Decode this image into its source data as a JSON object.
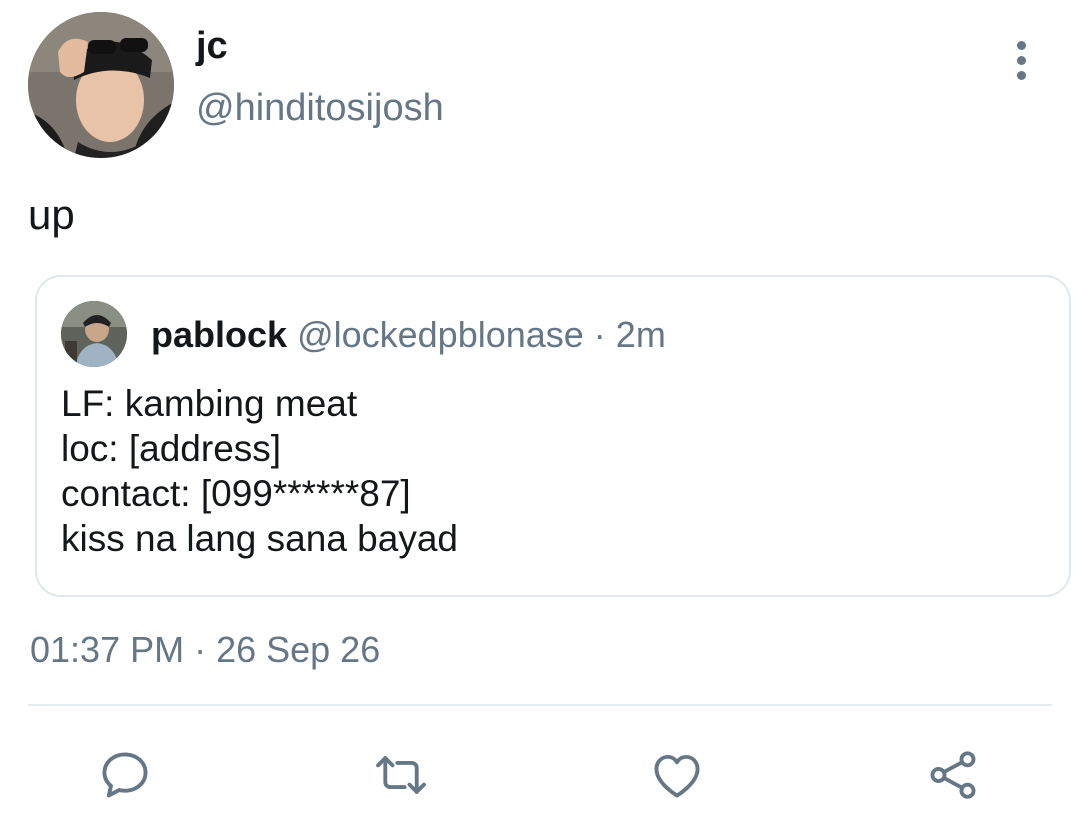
{
  "tweet": {
    "author": {
      "display_name": "jc",
      "handle": "@hinditosijosh"
    },
    "text": "up",
    "timestamp": "01:37 PM · 26 Sep 26"
  },
  "quoted_tweet": {
    "author": {
      "display_name": "pablock",
      "handle": "@lockedpblonase"
    },
    "time_sep": " · ",
    "time": "2m",
    "lines": [
      "LF: kambing meat",
      "loc: [address]",
      "contact: [099******87]",
      "kiss na lang sana bayad"
    ]
  },
  "actions": {
    "icons": [
      "reply-icon",
      "retweet-icon",
      "like-icon",
      "share-icon"
    ]
  },
  "colors": {
    "primary_text": "#14171a",
    "secondary_text": "#657786",
    "border": "#e1e8ed"
  }
}
